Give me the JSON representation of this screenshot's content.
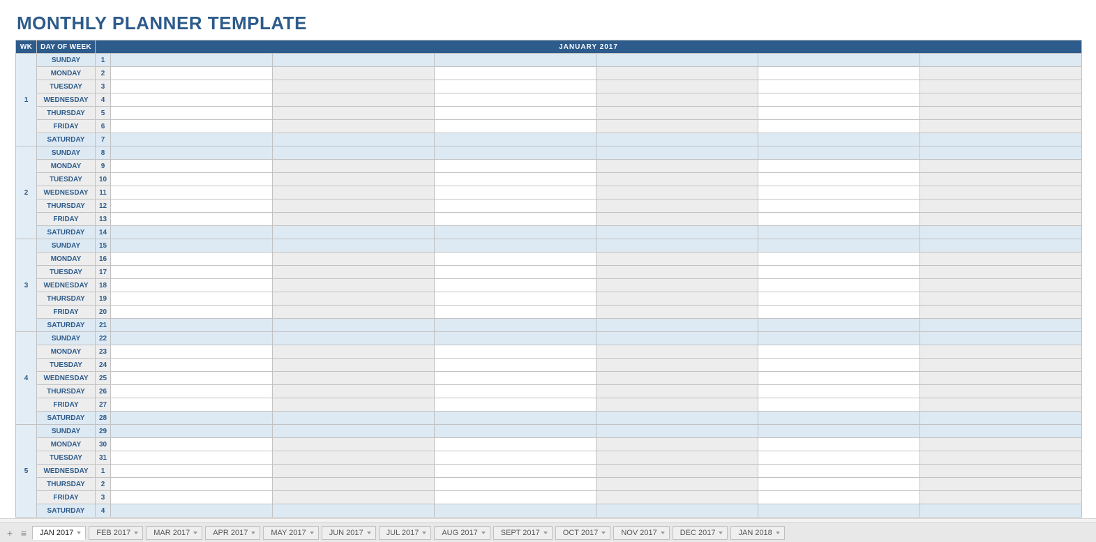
{
  "title": "MONTHLY PLANNER TEMPLATE",
  "header": {
    "wk": "WK",
    "dow": "DAY OF WEEK",
    "month": "JANUARY 2017"
  },
  "days_of_week": [
    "SUNDAY",
    "MONDAY",
    "TUESDAY",
    "WEDNESDAY",
    "THURSDAY",
    "FRIDAY",
    "SATURDAY"
  ],
  "weeks": [
    {
      "wk": "1",
      "dates": [
        "1",
        "2",
        "3",
        "4",
        "5",
        "6",
        "7"
      ]
    },
    {
      "wk": "2",
      "dates": [
        "8",
        "9",
        "10",
        "11",
        "12",
        "13",
        "14"
      ]
    },
    {
      "wk": "3",
      "dates": [
        "15",
        "16",
        "17",
        "18",
        "19",
        "20",
        "21"
      ]
    },
    {
      "wk": "4",
      "dates": [
        "22",
        "23",
        "24",
        "25",
        "26",
        "27",
        "28"
      ]
    },
    {
      "wk": "5",
      "dates": [
        "29",
        "30",
        "31",
        "1",
        "2",
        "3",
        "4"
      ]
    }
  ],
  "slot_columns": 6,
  "tabs": [
    {
      "label": "JAN 2017",
      "active": true
    },
    {
      "label": "FEB 2017",
      "active": false
    },
    {
      "label": "MAR 2017",
      "active": false
    },
    {
      "label": "APR 2017",
      "active": false
    },
    {
      "label": "MAY 2017",
      "active": false
    },
    {
      "label": "JUN 2017",
      "active": false
    },
    {
      "label": "JUL 2017",
      "active": false
    },
    {
      "label": "AUG 2017",
      "active": false
    },
    {
      "label": "SEPT 2017",
      "active": false
    },
    {
      "label": "OCT 2017",
      "active": false
    },
    {
      "label": "NOV 2017",
      "active": false
    },
    {
      "label": "DEC 2017",
      "active": false
    },
    {
      "label": "JAN 2018",
      "active": false
    }
  ]
}
